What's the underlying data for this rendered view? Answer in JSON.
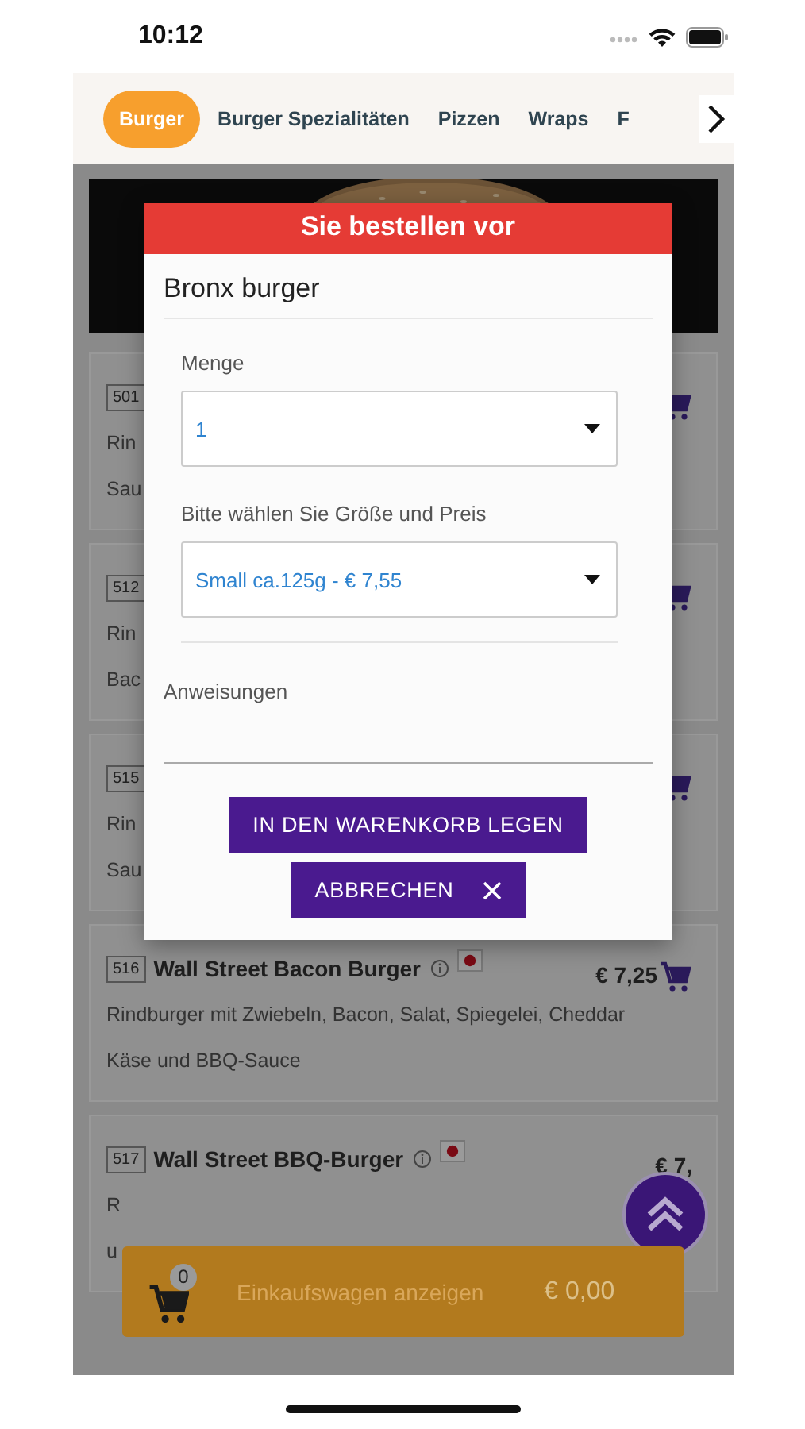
{
  "status_bar": {
    "time": "10:12"
  },
  "tabs": [
    {
      "label": "Burger",
      "selected": true
    },
    {
      "label": "Burger Spezialitäten",
      "selected": false
    },
    {
      "label": "Pizzen",
      "selected": false
    },
    {
      "label": "Wraps",
      "selected": false
    },
    {
      "label": "F",
      "selected": false
    }
  ],
  "items": [
    {
      "code": "501",
      "description": [
        "Rin",
        "Sau"
      ],
      "cart": true
    },
    {
      "code": "512",
      "description": [
        "Rin",
        "Bac"
      ],
      "cart": true
    },
    {
      "code": "515",
      "description": [
        "Rin",
        "Sau"
      ],
      "cart": true
    },
    {
      "code": "516",
      "title": "Wall Street Bacon Burger",
      "price": "€ 7,25",
      "description": [
        "Rindburger mit Zwiebeln, Bacon, Salat, Spiegelei, Cheddar",
        "Käse und BBQ-Sauce"
      ],
      "cart": true
    },
    {
      "code": "517",
      "title": "Wall Street BBQ-Burger",
      "price": "€ 7,",
      "description": [
        "R",
        "u"
      ],
      "cart": false
    }
  ],
  "dialog": {
    "title": "Sie bestellen vor",
    "product": "Bronx burger",
    "fields": [
      {
        "kind": "select",
        "label": "Menge",
        "value": "1"
      },
      {
        "kind": "select",
        "label": "Bitte wählen Sie Größe und Preis",
        "value": "Small ca.125g - € 7,55"
      },
      {
        "kind": "textarea",
        "label": "Anweisungen"
      }
    ],
    "buttons": [
      {
        "kind": "primary",
        "label": "IN DEN WARENKORB LEGEN"
      },
      {
        "kind": "cancel",
        "label": "ABBRECHEN"
      }
    ]
  },
  "cart": {
    "count": "0",
    "label": "Einkaufswagen anzeigen",
    "total": "€ 0,00"
  }
}
